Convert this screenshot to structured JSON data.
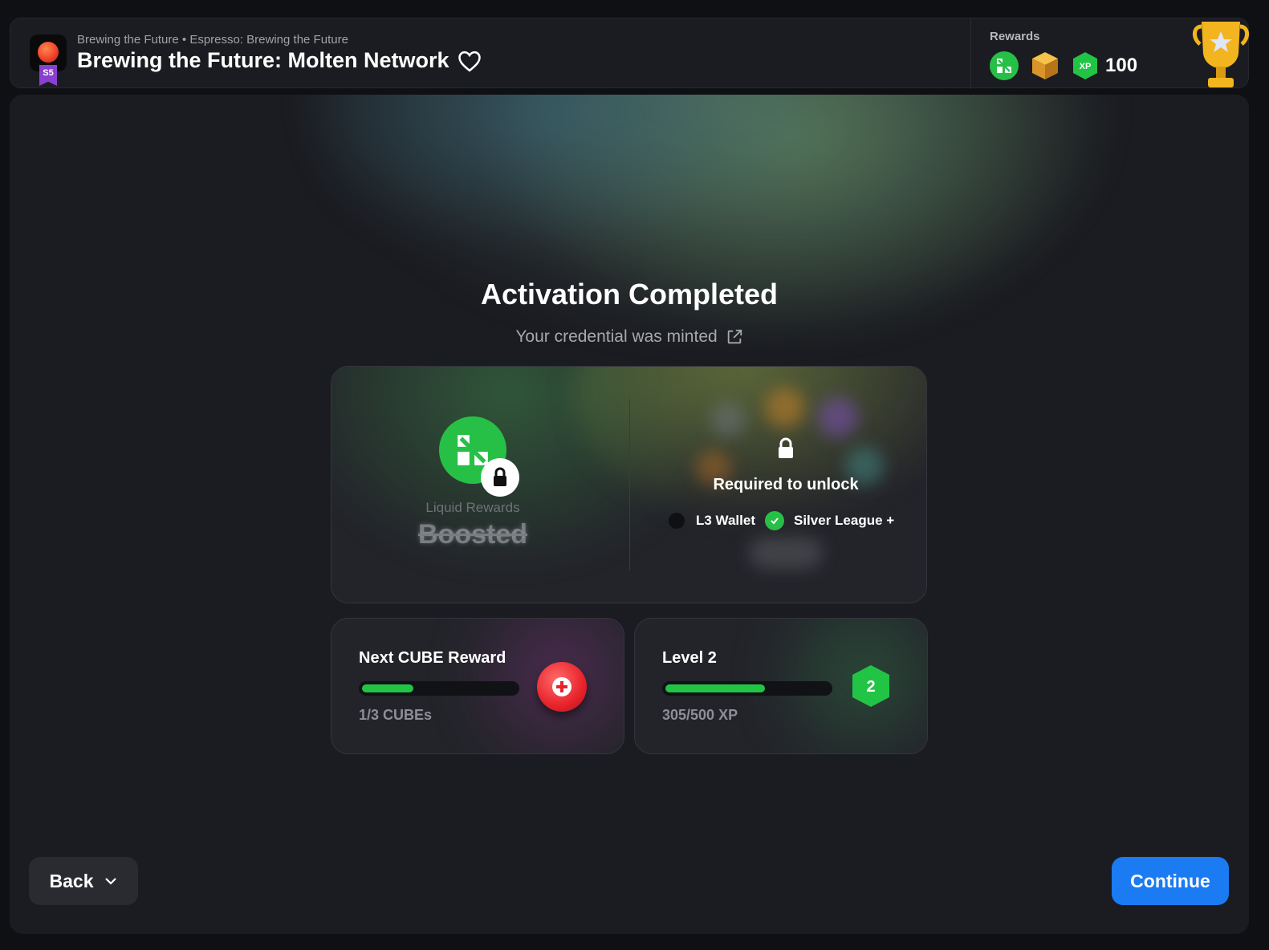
{
  "header": {
    "breadcrumb": "Brewing the Future • Espresso: Brewing the Future",
    "title": "Brewing the Future: Molten Network",
    "season_badge": "S5",
    "rewards_label": "Rewards",
    "xp_amount": "100",
    "xp_badge": "XP",
    "icons": [
      "liquid-rewards-icon",
      "cube-icon",
      "xp-hex-icon",
      "trophy-icon",
      "heart-icon"
    ]
  },
  "main": {
    "title": "Activation Completed",
    "credential_text": "Your credential was minted",
    "reward_card": {
      "liquid_label": "Liquid Rewards",
      "boosted_label": "Boosted",
      "unlock_title": "Required to unlock",
      "requirements": [
        {
          "label": "L3 Wallet",
          "met": false
        },
        {
          "label": "Silver League +",
          "met": true
        }
      ]
    },
    "cube_card": {
      "title": "Next CUBE Reward",
      "progress_text": "1/3 CUBEs",
      "progress_fraction": 0.333
    },
    "level_card": {
      "title": "Level 2",
      "progress_text": "305/500 XP",
      "progress_fraction": 0.61,
      "level_badge": "2"
    }
  },
  "footer": {
    "back_label": "Back",
    "continue_label": "Continue"
  },
  "colors": {
    "accent_blue": "#1a7bf2",
    "success_green": "#26c046",
    "background": "#1b1c21"
  }
}
